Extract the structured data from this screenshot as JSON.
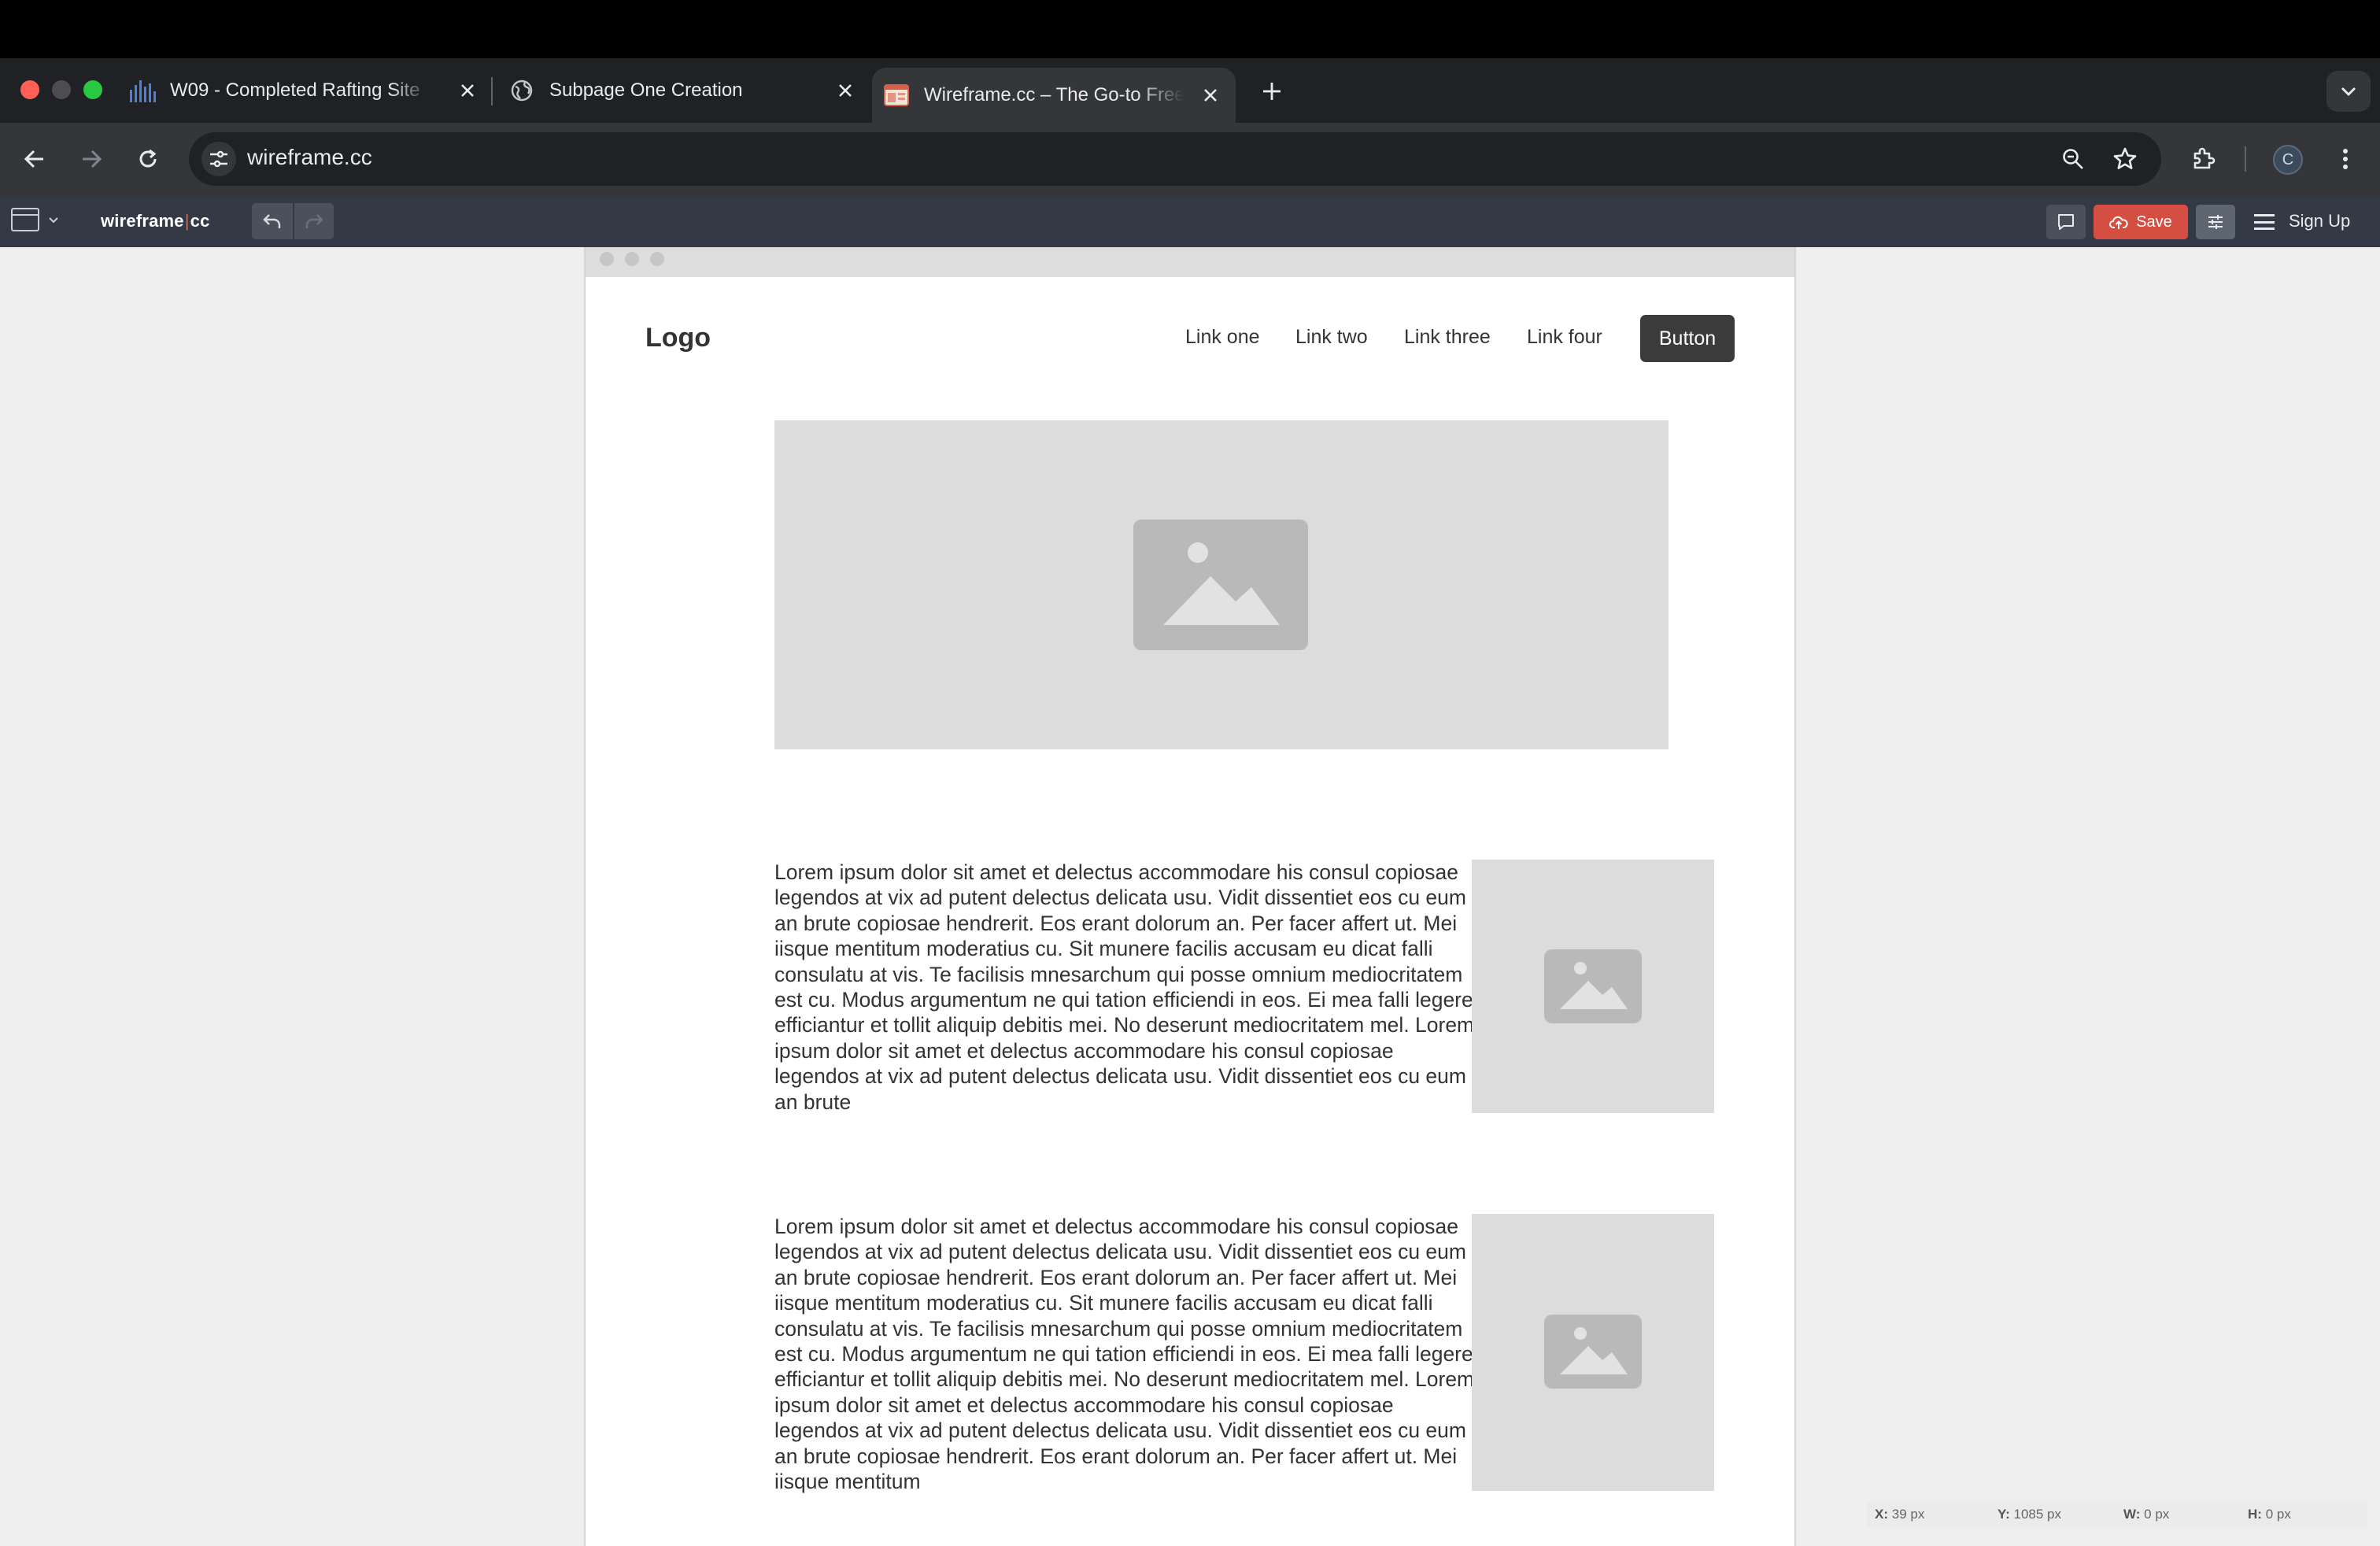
{
  "browser": {
    "tabs": [
      {
        "title": "W09 - Completed Rafting Site",
        "active": false
      },
      {
        "title": "Subpage One Creation",
        "active": false
      },
      {
        "title": "Wireframe.cc – The Go-to Free",
        "active": true
      }
    ],
    "url": "wireframe.cc",
    "profile_initial": "C"
  },
  "app": {
    "logo_left": "wireframe",
    "logo_sep": "|",
    "logo_right": "cc",
    "save_label": "Save",
    "signup_label": "Sign Up"
  },
  "wireframe": {
    "logo": "Logo",
    "nav_links": [
      "Link one",
      "Link two",
      "Link three",
      "Link four"
    ],
    "button_label": "Button",
    "sections": [
      {
        "text": "Lorem ipsum dolor sit amet et delectus accommodare his consul copiosae legendos at vix ad putent delectus delicata usu. Vidit dissentiet eos cu eum an brute copiosae hendrerit. Eos erant dolorum an. Per facer affert ut. Mei iisque mentitum moderatius cu. Sit munere facilis accusam eu dicat falli consulatu at vis. Te facilisis mnesarchum qui posse omnium mediocritatem est cu. Modus argumentum ne qui tation efficiendi in eos. Ei mea falli legere efficiantur et tollit aliquip debitis mei. No deserunt mediocritatem mel. Lorem ipsum dolor sit amet et delectus accommodare his consul copiosae legendos at vix ad putent delectus delicata usu. Vidit dissentiet eos cu eum an brute"
      },
      {
        "text": "Lorem ipsum dolor sit amet et delectus accommodare his consul copiosae legendos at vix ad putent delectus delicata usu. Vidit dissentiet eos cu eum an brute copiosae hendrerit. Eos erant dolorum an. Per facer affert ut. Mei iisque mentitum moderatius cu. Sit munere facilis accusam eu dicat falli consulatu at vis. Te facilisis mnesarchum qui posse omnium mediocritatem est cu. Modus argumentum ne qui tation efficiendi in eos. Ei mea falli legere efficiantur et tollit aliquip debitis mei. No deserunt mediocritatem mel. Lorem ipsum dolor sit amet et delectus accommodare his consul copiosae legendos at vix ad putent delectus delicata usu. Vidit dissentiet eos cu eum an brute copiosae hendrerit. Eos erant dolorum an. Per facer affert ut. Mei iisque mentitum"
      }
    ]
  },
  "status": {
    "x_label": "X:",
    "x_value": "39 px",
    "y_label": "Y:",
    "y_value": "1085 px",
    "w_label": "W:",
    "w_value": "0 px",
    "h_label": "H:",
    "h_value": "0 px"
  },
  "colors": {
    "save_button": "#d44e42",
    "wireframe_button": "#3b3b3b",
    "placeholder": "#dcdcdc",
    "chrome_dark": "#202124"
  }
}
